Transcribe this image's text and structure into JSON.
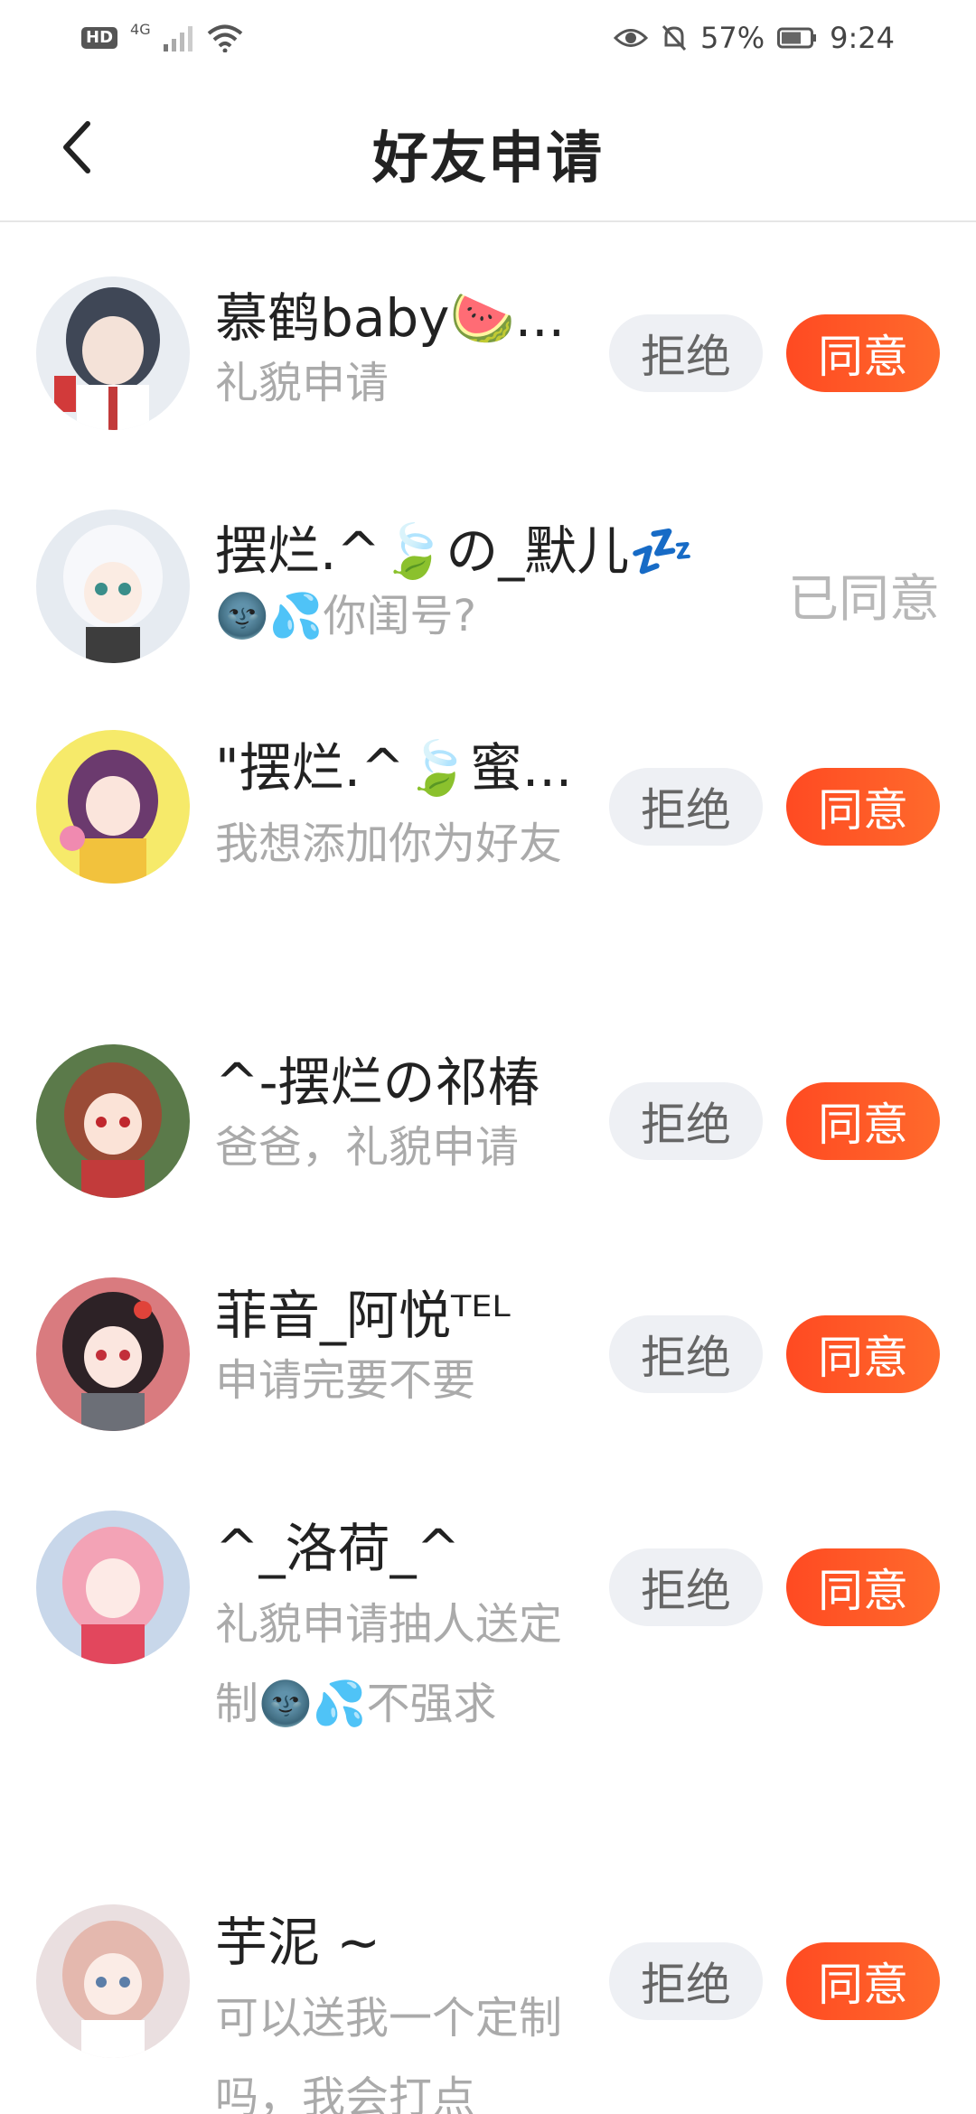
{
  "status_bar": {
    "hd": "HD",
    "network": "4G",
    "battery_percent": "57%",
    "time": "9:24"
  },
  "header": {
    "title": "好友申请"
  },
  "requests": [
    {
      "name": "慕鹤baby🍉...",
      "message": "礼貌申请",
      "state": "pending",
      "reject_label": "拒绝",
      "accept_label": "同意",
      "avatar_color": "#6f7d93"
    },
    {
      "name": "摆烂.^🍃の_默儿💤",
      "message": "🌚💦你闺号?",
      "state": "accepted",
      "accepted_label": "已同意",
      "avatar_color": "#dfe6ee"
    },
    {
      "name": "\"摆烂.^🍃蜜...",
      "message": "我想添加你为好友",
      "state": "pending",
      "reject_label": "拒绝",
      "accept_label": "同意",
      "avatar_color": "#f4e86a"
    },
    {
      "name": "^-摆烂の祁椿",
      "message": "爸爸，礼貌申请",
      "state": "pending",
      "reject_label": "拒绝",
      "accept_label": "同意",
      "avatar_color": "#a8573f"
    },
    {
      "name": "菲音_阿悦ᵀᴱᴸ",
      "message": "申请完要不要",
      "state": "pending",
      "reject_label": "拒绝",
      "accept_label": "同意",
      "avatar_color": "#c9656b"
    },
    {
      "name": "^_洛荷_^",
      "message": "礼貌申请抽人送定制🌚💦不强求",
      "state": "pending",
      "reject_label": "拒绝",
      "accept_label": "同意",
      "avatar_color": "#f2a7b7"
    },
    {
      "name": "芋泥 ~",
      "message": "可以送我一个定制吗，我会打点",
      "state": "pending",
      "reject_label": "拒绝",
      "accept_label": "同意",
      "avatar_color": "#d9b3ad"
    }
  ],
  "colors": {
    "accent": "#ff5a25",
    "reject_bg": "#eef0f4",
    "muted_text": "#aaaaaa"
  }
}
